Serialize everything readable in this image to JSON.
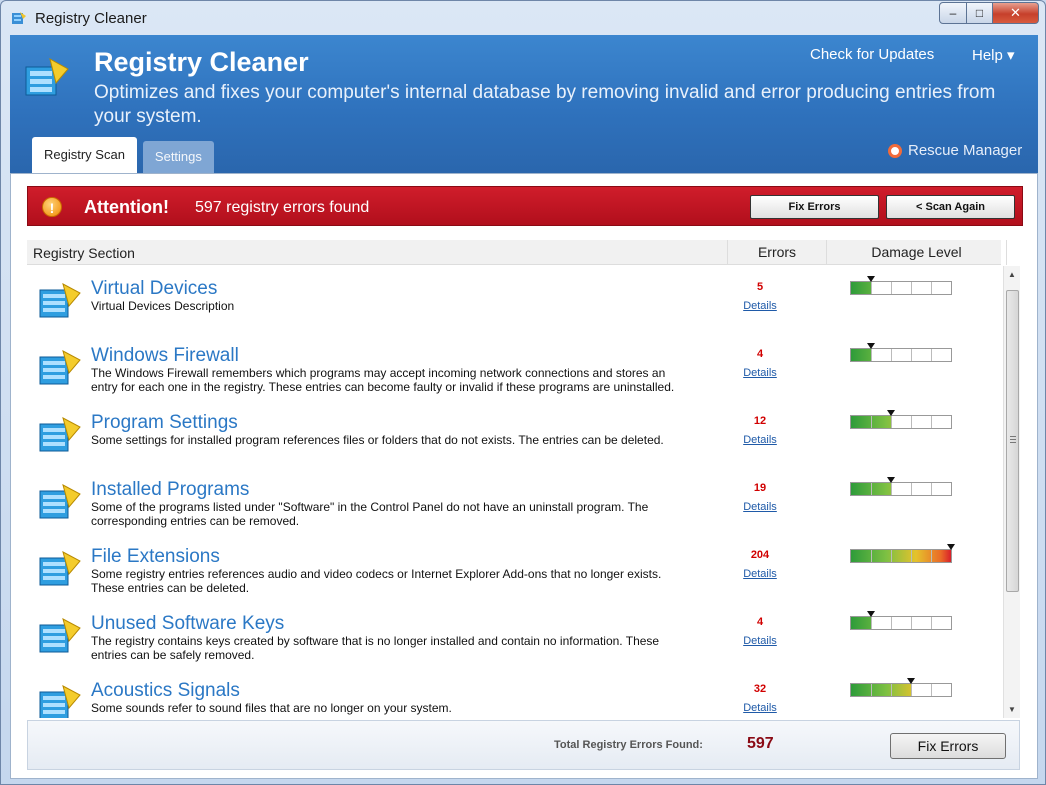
{
  "window": {
    "title": "Registry Cleaner",
    "buttons": {
      "min": "–",
      "max": "□",
      "close": "✕"
    }
  },
  "header": {
    "title": "Registry Cleaner",
    "description": "Optimizes and fixes your computer's internal database by removing invalid and error producing entries from your system.",
    "check_updates": "Check for Updates",
    "help": "Help ▾",
    "rescue_manager": "Rescue Manager",
    "tabs": [
      {
        "label": "Registry Scan",
        "active": true
      },
      {
        "label": "Settings",
        "active": false
      }
    ]
  },
  "alert": {
    "title": "Attention!",
    "message": "597 registry errors found",
    "fix_button": "Fix Errors",
    "scan_again_button": "< Scan Again",
    "icon": "info-icon"
  },
  "columns": {
    "section": "Registry Section",
    "errors": "Errors",
    "damage": "Damage Level"
  },
  "rows": [
    {
      "title": "Virtual Devices",
      "description": "Virtual Devices Description",
      "errors": "5",
      "details": "Details",
      "damage_level": 0.2
    },
    {
      "title": "Windows Firewall",
      "description": "The Windows Firewall remembers which programs may accept incoming network connections and stores an entry for each one in the registry. These entries can become faulty or invalid if these programs are uninstalled.",
      "errors": "4",
      "details": "Details",
      "damage_level": 0.2
    },
    {
      "title": "Program Settings",
      "description": "Some settings for installed program references files or folders that do not exists. The entries can be deleted.",
      "errors": "12",
      "details": "Details",
      "damage_level": 0.4
    },
    {
      "title": "Installed Programs",
      "description": "Some of the programs listed under \"Software\" in the Control Panel do not have an uninstall program. The corresponding entries can be removed.",
      "errors": "19",
      "details": "Details",
      "damage_level": 0.4
    },
    {
      "title": "File Extensions",
      "description": "Some registry entries references audio and video codecs or Internet Explorer Add-ons that no longer exists. These entries can be deleted.",
      "errors": "204",
      "details": "Details",
      "damage_level": 1.0
    },
    {
      "title": "Unused Software Keys",
      "description": "The registry contains keys created by software that is no longer installed and contain no information. These entries can be safely removed.",
      "errors": "4",
      "details": "Details",
      "damage_level": 0.2
    },
    {
      "title": "Acoustics Signals",
      "description": "Some sounds refer to sound files that are no longer on your system.",
      "errors": "32",
      "details": "Details",
      "damage_level": 0.6
    }
  ],
  "footer": {
    "total_label": "Total Registry Errors Found:",
    "total_value": "597",
    "fix_button": "Fix Errors"
  },
  "colors": {
    "header": "#2f72bd",
    "alert": "#c3141f",
    "link": "#2b78c5",
    "error_count": "#d10000"
  }
}
